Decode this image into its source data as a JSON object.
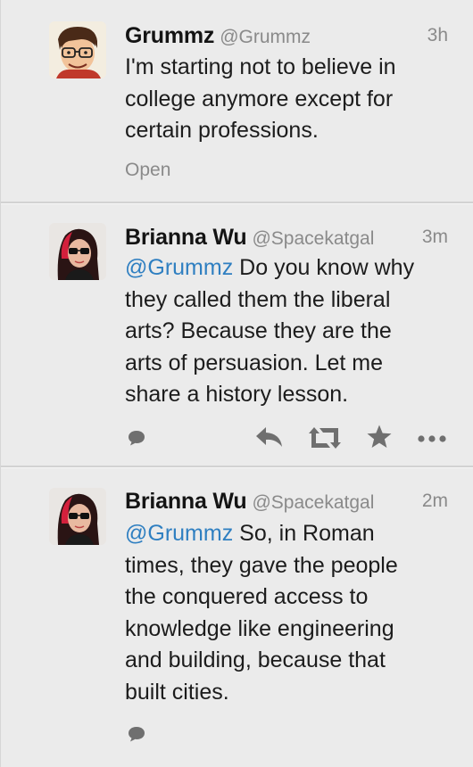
{
  "tweets": [
    {
      "name": "Grummz",
      "handle": "@Grummz",
      "time": "3h",
      "mention": "",
      "text": "I'm starting not to believe in college anymore except for certain professions.",
      "lines": [
        "I'm starting not to believe in",
        "college anymore except for",
        "certain professions."
      ],
      "open_label": "Open",
      "avatar_icon": "cartoon-avatar"
    },
    {
      "name": "Brianna Wu",
      "handle": "@Spacekatgal",
      "time": "3m",
      "mention": "@Grummz",
      "lines": [
        " Do you know why",
        "they called them the liberal",
        "arts? Because they are the",
        "arts of persuasion. Let me",
        "share a history lesson."
      ],
      "avatar_icon": "photo-avatar",
      "actions": [
        "reply-icon",
        "retweet-icon",
        "favorite-star-icon",
        "more-dots-icon"
      ],
      "conversation_icon": "speech-bubble-icon"
    },
    {
      "name": "Brianna Wu",
      "handle": "@Spacekatgal",
      "time": "2m",
      "mention": "@Grummz",
      "lines": [
        " So, in Roman",
        "times, they gave the people",
        "the conquered access to",
        "knowledge like engineering",
        "and building, because that",
        "built cities."
      ],
      "avatar_icon": "photo-avatar",
      "conversation_icon": "speech-bubble-icon"
    }
  ],
  "colors": {
    "background": "#ebebeb",
    "mention": "#2f7fc1",
    "meta_gray": "#8a8a8a",
    "action_gray": "#6f6f6f"
  }
}
